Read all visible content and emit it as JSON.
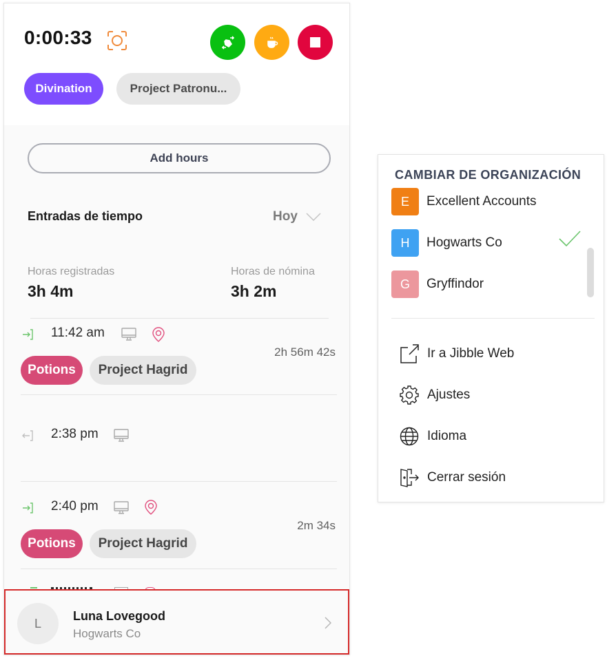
{
  "timer": {
    "elapsed": "0:00:33",
    "actions": [
      {
        "name": "switch-activity",
        "color": "#09c011"
      },
      {
        "name": "break",
        "color": "#ffaa12"
      },
      {
        "name": "clock-out",
        "color": "#e1063e"
      }
    ]
  },
  "current": {
    "activity": {
      "label": "Divination",
      "color": "#7d4dfe"
    },
    "project": {
      "label": "Project Patronu..."
    }
  },
  "add_hours_label": "Add hours",
  "time_entries": {
    "title": "Entradas de tiempo",
    "period": "Hoy",
    "stats": {
      "tracked_label": "Horas registradas",
      "tracked_value": "3h 4m",
      "payroll_label": "Horas de nómina",
      "payroll_value": "3h 2m"
    },
    "entries": [
      {
        "type": "in",
        "time": "11:42 am",
        "has_location": true,
        "duration": "2h 56m 42s",
        "activity": "Potions",
        "project": "Project Hagrid"
      },
      {
        "type": "out",
        "time": "2:38 pm",
        "has_location": false
      },
      {
        "type": "in",
        "time": "2:40 pm",
        "has_location": true,
        "duration": "2m 34s",
        "activity": "Potions",
        "project": "Project Hagrid"
      }
    ]
  },
  "user": {
    "initial": "L",
    "name": "Luna Lovegood",
    "organization": "Hogwarts Co"
  },
  "menu": {
    "title": "CAMBIAR DE ORGANIZACIÓN",
    "organizations": [
      {
        "initial": "E",
        "name": "Excellent Accounts",
        "color": "#f07f14",
        "selected": false
      },
      {
        "initial": "H",
        "name": "Hogwarts Co",
        "color": "#3fa2f2",
        "selected": true
      },
      {
        "initial": "G",
        "name": "Gryffindor",
        "color": "#ec979d",
        "selected": false
      }
    ],
    "items": [
      {
        "icon": "external-link-icon",
        "label": "Ir a Jibble Web"
      },
      {
        "icon": "gear-icon",
        "label": "Ajustes"
      },
      {
        "icon": "globe-icon",
        "label": "Idioma"
      },
      {
        "icon": "logout-icon",
        "label": "Cerrar sesión"
      }
    ]
  }
}
